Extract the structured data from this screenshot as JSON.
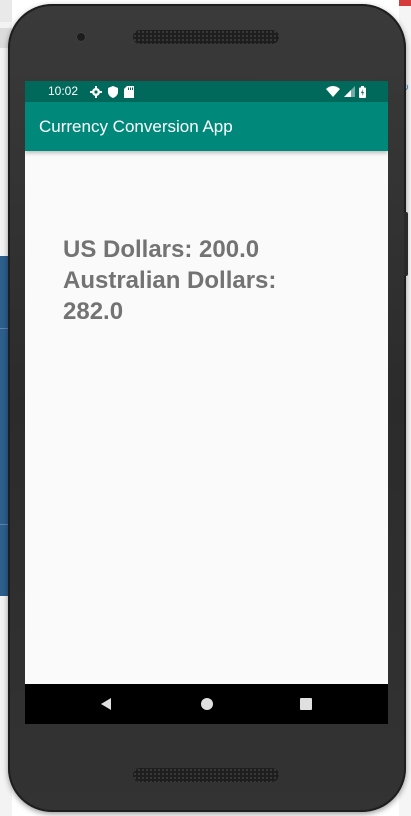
{
  "status_bar": {
    "time": "10:02",
    "left_icons": [
      "settings-icon",
      "shield-icon",
      "sd-card-icon"
    ],
    "right_icons": [
      "wifi-icon",
      "cell-signal-icon",
      "battery-icon"
    ],
    "color": "#00695c"
  },
  "app_bar": {
    "title": "Currency Conversion App",
    "color": "#00897b"
  },
  "content": {
    "us_line": "US Dollars: 200.0",
    "aud_line_label": "Australian Dollars:",
    "aud_value": "282.0",
    "text_color": "#737373"
  },
  "nav_bar": {
    "buttons": [
      "back",
      "home",
      "recents"
    ]
  }
}
